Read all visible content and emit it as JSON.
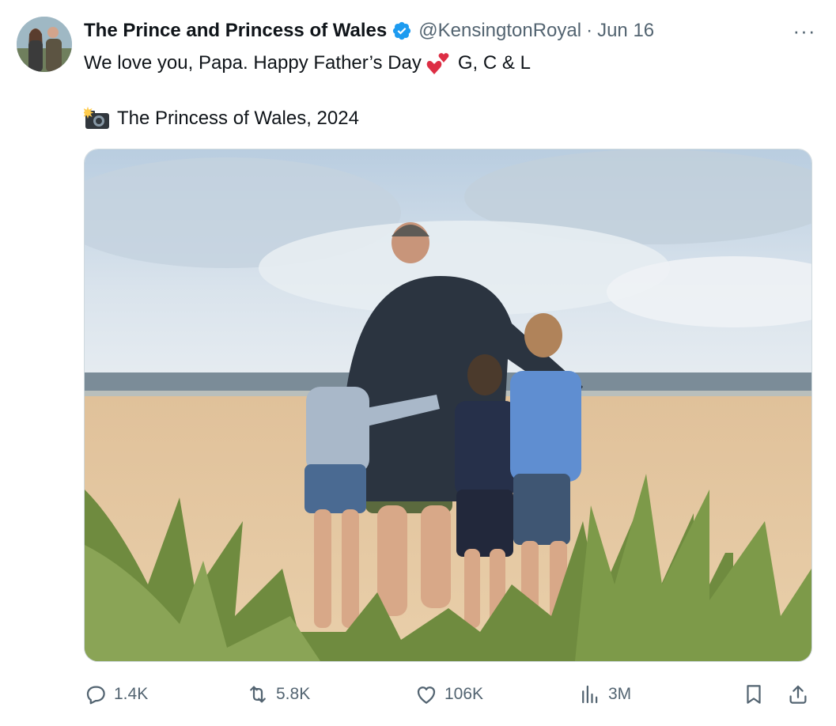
{
  "tweet": {
    "author_name": "The Prince and Princess of Wales",
    "handle": "@KensingtonRoyal",
    "separator": "·",
    "date": "Jun 16",
    "more_label": "···",
    "text_line1_before": "We love you, Papa. Happy Father’s Day",
    "text_line1_after": "G, C & L",
    "text_line2": "The Princess of Wales, 2024",
    "icons": {
      "verified": "verified-badge-icon",
      "hearts": "two-hearts-emoji",
      "camera": "camera-flash-emoji"
    }
  },
  "actions": {
    "replies": "1.4K",
    "reposts": "5.8K",
    "likes": "106K",
    "views": "3M"
  },
  "colors": {
    "text_primary": "#0f1419",
    "text_secondary": "#536471",
    "verified_blue": "#1d9bf0",
    "border": "#cfd9de"
  }
}
